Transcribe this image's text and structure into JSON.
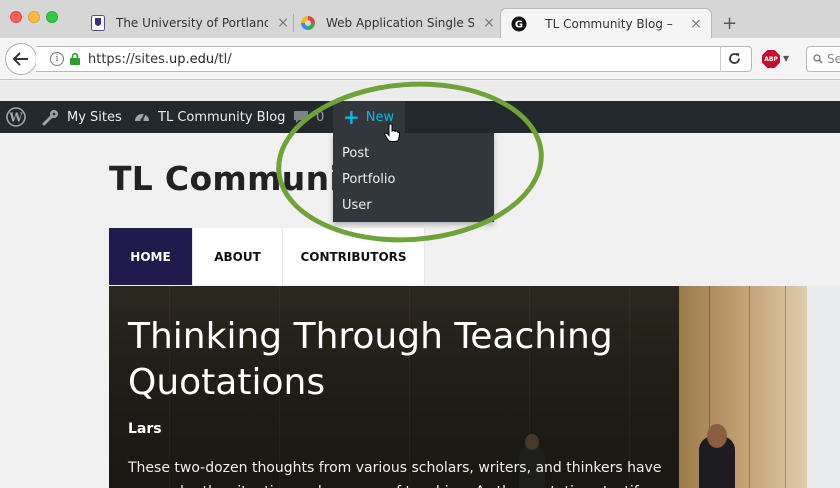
{
  "browser": {
    "tabs": [
      {
        "title": "The University of Portland",
        "favicon": "up-shield-icon",
        "active": false
      },
      {
        "title": "Web Application Single Sig…",
        "favicon": "pinwheel-icon",
        "active": false
      },
      {
        "title": "TL Community Blog –",
        "favicon": "g-circle-icon",
        "active": true
      }
    ],
    "url_prefix": "https://sites.",
    "url_host": "up.edu",
    "url_path": "/tl/",
    "search_placeholder": "Se",
    "abp_label": "ABP"
  },
  "adminbar": {
    "my_sites": "My Sites",
    "blog_name": "TL Community Blog",
    "comment_count": "0",
    "new_label": "New",
    "new_menu": [
      "Post",
      "Portfolio",
      "User"
    ]
  },
  "site": {
    "title": "TL Communi",
    "menu": [
      "HOME",
      "ABOUT",
      "CONTRIBUTORS"
    ],
    "post_title": "Thinking Through Teaching Quotations",
    "post_author": "Lars",
    "post_excerpt": "These two-dozen thoughts from various scholars, writers, and thinkers have us ponder the situation and purpose of teaching. As the quotations testify"
  },
  "colors": {
    "annotation": "#6fa33a",
    "adminbar_bg": "#23282d",
    "accent_new": "#00b9eb",
    "menu_active_bg": "#201a4d"
  }
}
